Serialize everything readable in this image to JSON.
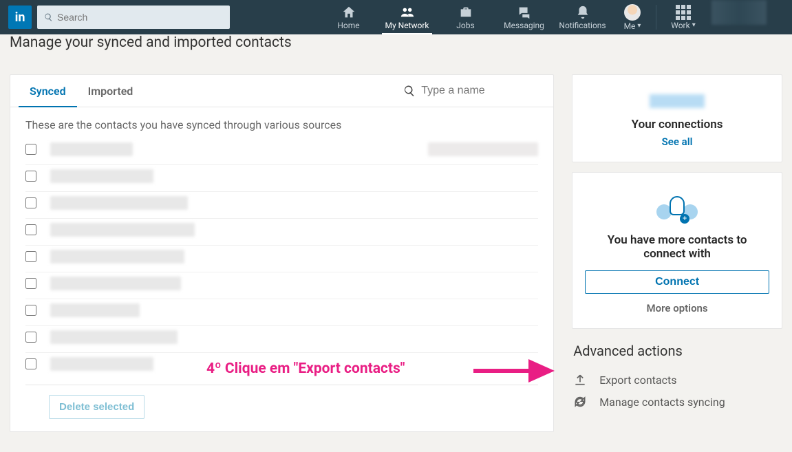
{
  "nav": {
    "logo": "in",
    "search_placeholder": "Search",
    "items": [
      {
        "label": "Home"
      },
      {
        "label": "My Network"
      },
      {
        "label": "Jobs"
      },
      {
        "label": "Messaging"
      },
      {
        "label": "Notifications"
      },
      {
        "label": "Me"
      },
      {
        "label": "Work"
      }
    ]
  },
  "page": {
    "title": "Manage your synced and imported contacts",
    "tabs": {
      "synced": "Synced",
      "imported": "Imported"
    },
    "filter_placeholder": "Type a name",
    "subtext": "These are the contacts you have synced through various sources",
    "delete_label": "Delete selected"
  },
  "right": {
    "connections_title": "Your connections",
    "see_all": "See all",
    "connect_prompt": "You have more contacts to connect with",
    "connect_btn": "Connect",
    "more_options": "More options"
  },
  "advanced": {
    "title": "Advanced actions",
    "export": "Export contacts",
    "manage": "Manage contacts syncing"
  },
  "annotation": {
    "text": "4º Clique em \"Export contacts\""
  }
}
